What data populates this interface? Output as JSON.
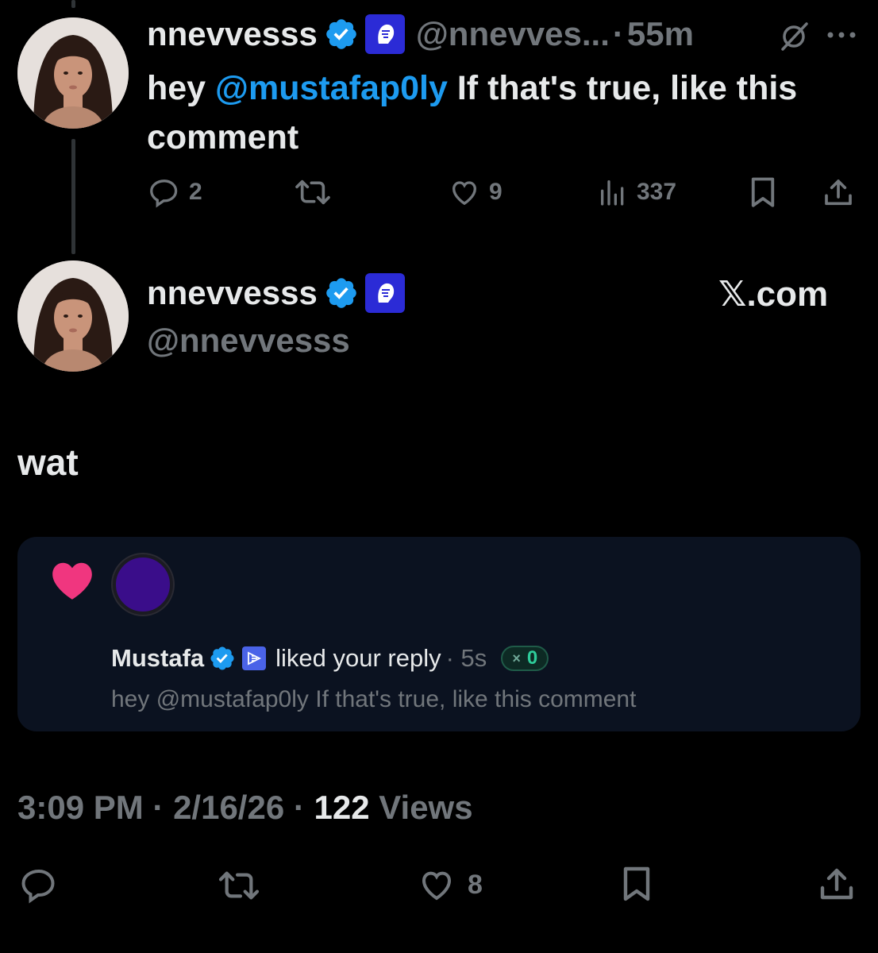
{
  "parent_tweet": {
    "display_name": "nnevvesss",
    "handle": "@nnevves...",
    "separator": "·",
    "timestamp": "55m",
    "text_prefix": "hey ",
    "mention": "@mustafap0ly",
    "text_suffix": " If that's true, like this comment",
    "actions": {
      "replies": "2",
      "reposts": "",
      "likes": "9",
      "views": "337"
    }
  },
  "main_tweet": {
    "display_name": "nnevvesss",
    "handle": "@nnevvesss",
    "source": "𝕏.com",
    "text": "wat",
    "time": "3:09 PM",
    "separator1": " · ",
    "date": "2/16/26",
    "separator2": " · ",
    "views_count": "122",
    "views_label": " Views",
    "actions": {
      "likes": "8"
    }
  },
  "notification": {
    "name": "Mustafa",
    "action": "liked your reply",
    "time": "· 5s",
    "chip_icon": "×",
    "chip_value": "0",
    "text": "hey @mustafap0ly If that's true, like this comment"
  },
  "colors": {
    "accent": "#1d9bf0",
    "background": "#000000",
    "muted": "#71767b",
    "text": "#e7e9ea",
    "heart": "#f91880",
    "card": "#0b1220"
  },
  "icons": [
    "verified-badge-icon",
    "affiliate-badge-icon",
    "grok-icon",
    "more-icon",
    "reply-icon",
    "repost-icon",
    "like-icon",
    "views-icon",
    "bookmark-icon",
    "share-icon",
    "heart-icon"
  ]
}
